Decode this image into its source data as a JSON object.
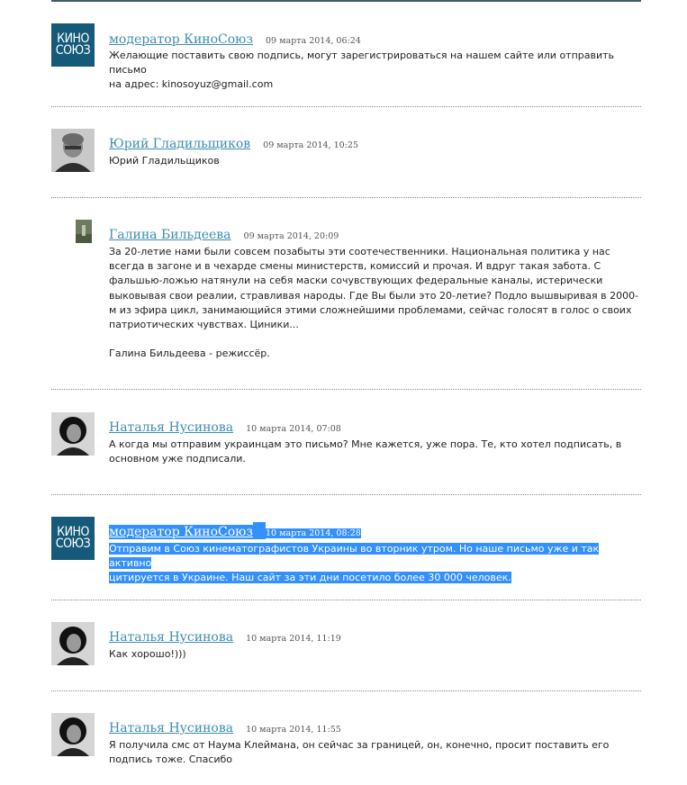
{
  "comments": [
    {
      "author": "модератор КиноСоюз",
      "date": "09 марта 2014, 06:24",
      "avatar": "kinosoyuz-logo",
      "logo_line1": "КИНО",
      "logo_line2": "СОЮЗ",
      "lines": [
        "Желающие поставить свою подпись, могут зарегистрироваться на нашем сайте или отправить письмо",
        "на адрес: kinosoyuz@gmail.com"
      ]
    },
    {
      "author": "Юрий Гладильщиков",
      "date": "09 марта 2014, 10:25",
      "avatar": "man-photo",
      "lines": [
        "Юрий Гладильщиков"
      ]
    },
    {
      "author": "Галина Бильдеева",
      "date": "09 марта 2014, 20:09",
      "avatar": "outdoor-photo",
      "lines": [
        "За 20-летие нами были совсем позабыты  эти соотечественники. Национальная политика у нас",
        "всегда в загоне и  в чехарде смены министерств, комиссий и прочая. И вдруг такая забота. С",
        "фальшью-ложью натянули на себя маски сочувствующих федеральные каналы, истерически",
        "выковывая свои реалии, стравливая народы. Где Вы были это 20-летие?  Подло вышвыривая в 2000-",
        "м  из эфира цикл, занимающийся этими сложнейшими проблемами, сейчас голосят в голос о своих",
        "патриотических чувствах. Циники..."
      ],
      "signature": "Галина Бильдеева - режиссёр."
    },
    {
      "author": "Наталья Нусинова",
      "date": "10 марта 2014, 07:08",
      "avatar": "woman-photo",
      "lines": [
        "А когда мы отправим украинцам это письмо? Мне кажется, уже пора. Те, кто хотел подписать, в",
        "основном уже подписали."
      ]
    },
    {
      "author": "модератор КиноСоюз",
      "date": "10 марта 2014, 08:28",
      "avatar": "kinosoyuz-logo",
      "logo_line1": "КИНО",
      "logo_line2": "СОЮЗ",
      "lines": [
        "Отправим в Союз кинематографистов Украины во вторник утром. Но наше письмо уже и так активно",
        "цитируется в Украине. Наш сайт за эти дни посетило более 30 000 человек."
      ],
      "selected": true
    },
    {
      "author": "Наталья Нусинова",
      "date": "10 марта 2014, 11:19",
      "avatar": "woman-photo",
      "lines": [
        "Как хорошо!)))"
      ]
    },
    {
      "author": "Наталья Нусинова",
      "date": "10 марта 2014, 11:55",
      "avatar": "woman-photo",
      "lines": [
        "Я получила смс от Наума Клеймана, он сейчас за границей, он, конечно, просит поставить его",
        "подпись тоже. Спасибо"
      ]
    }
  ],
  "colors": {
    "author_link": "#3c8fb0",
    "selection": "#3390ff",
    "logo_bg": "#155a78"
  }
}
